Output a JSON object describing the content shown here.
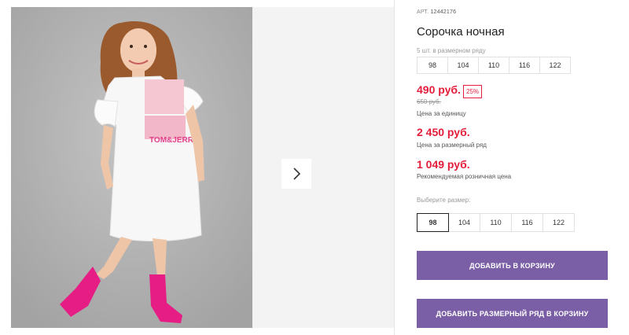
{
  "product": {
    "sku_label": "АРТ.",
    "sku_value": "12442176",
    "title": "Сорочка ночная",
    "size_run_note": "5 шт. в размерном ряду",
    "size_run": [
      "98",
      "104",
      "110",
      "116",
      "122"
    ],
    "price": "490 руб.",
    "discount_badge": "25%",
    "old_price": "650 руб.",
    "price_caption": "Цена за единицу",
    "run_price": "2 450 руб.",
    "run_price_caption": "Цена за размерный ряд",
    "rrp": "1 049 руб.",
    "rrp_caption": "Рекомендуемая розничная цена",
    "select_size_label": "Выберите размер:",
    "sizes": [
      "98",
      "104",
      "110",
      "116",
      "122"
    ],
    "selected_size": "98",
    "add_to_cart": "ДОБАВИТЬ В КОРЗИНУ",
    "add_run_to_cart": "ДОБАВИТЬ РАЗМЕРНЫЙ РЯД В КОРЗИНУ"
  },
  "icons": {
    "next": "chevron-right-icon"
  },
  "colors": {
    "price": "#e41d3a",
    "button": "#7b5fa6",
    "sock": "#e61d85"
  }
}
